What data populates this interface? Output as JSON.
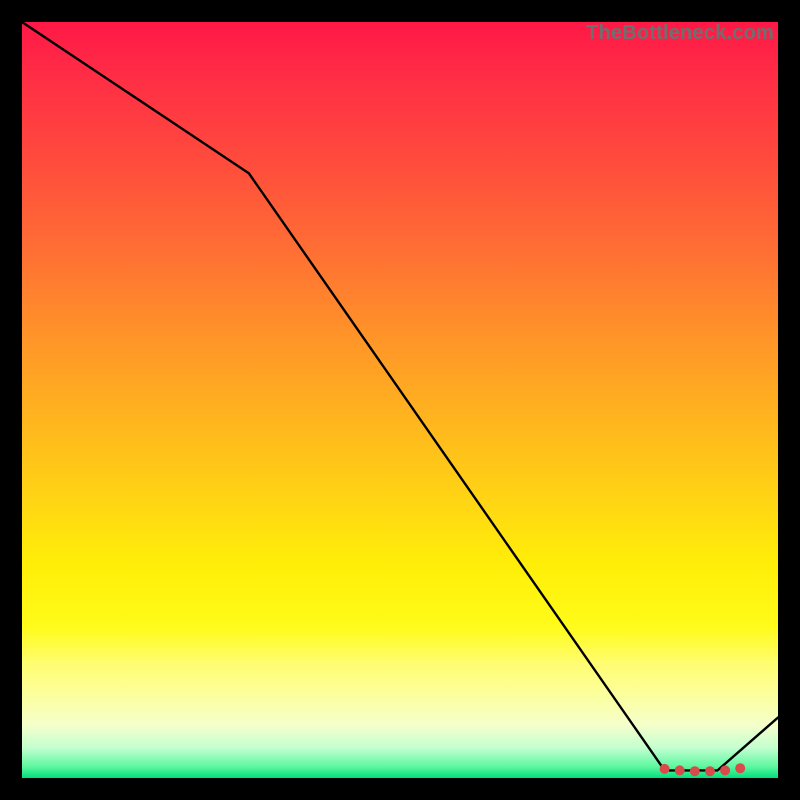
{
  "watermark": "TheBottleneck.com",
  "chart_data": {
    "type": "line",
    "title": "",
    "xlabel": "",
    "ylabel": "",
    "xlim": [
      0,
      100
    ],
    "ylim": [
      0,
      100
    ],
    "grid": false,
    "legend": false,
    "x": [
      0,
      30,
      85,
      92,
      100
    ],
    "values": [
      100,
      80,
      1,
      1,
      8
    ],
    "note": "Values are read off pixel positions; the chart has no visible axis ticks or labels so units are normalized 0-100.",
    "markers": {
      "description": "Short run of small red dots along the bottom edge near x≈85–95",
      "color": "#d94a4a",
      "points": [
        {
          "x": 85,
          "y": 1.2
        },
        {
          "x": 87,
          "y": 1.0
        },
        {
          "x": 89,
          "y": 0.9
        },
        {
          "x": 91,
          "y": 0.9
        },
        {
          "x": 93,
          "y": 1.0
        },
        {
          "x": 95,
          "y": 1.3
        }
      ]
    }
  }
}
